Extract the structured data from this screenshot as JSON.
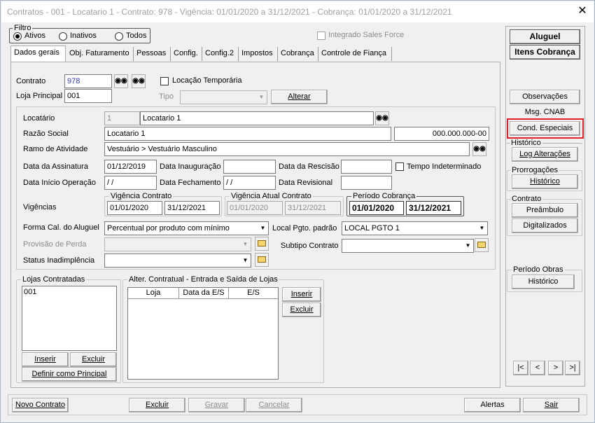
{
  "window": {
    "title": "Contratos - 001 - Locatario 1 - Contrato: 978 - Vigência: 01/01/2020 a 31/12/2021 - Cobrança: 01/01/2020 a 31/12/2021",
    "close": "✕"
  },
  "filtro": {
    "label": "Filtro",
    "options": [
      "Ativos",
      "Inativos",
      "Todos"
    ],
    "selected": "Ativos",
    "integrado": "Integrado Sales Force"
  },
  "tabs": [
    "Dados gerais",
    "Obj. Faturamento",
    "Pessoas",
    "Config.",
    "Config.2",
    "Impostos",
    "Cobrança",
    "Controle de Fiança"
  ],
  "contrato": {
    "label": "Contrato",
    "value": "978",
    "locacao_temporaria": "Locação Temporária",
    "loja_label": "Loja Principal",
    "loja_value": "001",
    "tipo_label": "Tipo",
    "alterar": "Alterar"
  },
  "form": {
    "locatario_label": "Locatário",
    "locatario_code": "1",
    "locatario_name": "Locatario 1",
    "razao_label": "Razão Social",
    "razao_value": "Locatario 1",
    "cnpj": "000.000.000-00",
    "ramo_label": "Ramo de Atividade",
    "ramo_value": "Vestuário > Vestuário Masculino",
    "assinatura_label": "Data da Assinatura",
    "assinatura_value": "01/12/2019",
    "inauguracao_label": "Data Inauguração",
    "rescisao_label": "Data da Rescisão",
    "tempo_indet": "Tempo Indeterminado",
    "inicio_op_label": "Data Início Operação",
    "inicio_op_value": " / /",
    "fechamento_label": "Data Fechamento",
    "fechamento_value": " / /",
    "revisional_label": "Data Revisional",
    "vigencias_label": "Vigências",
    "vig_contrato": {
      "title": "Vigência Contrato",
      "from": "01/01/2020",
      "to": "31/12/2021"
    },
    "vig_atual": {
      "title": "Vigência Atual Contrato",
      "from": "01/01/2020",
      "to": "31/12/2021"
    },
    "periodo_cob": {
      "title": "Período Cobrança",
      "from": "01/01/2020",
      "to": "31/12/2021"
    },
    "forma_label": "Forma Cal. do Aluguel",
    "forma_value": "Percentual por produto com mínimo",
    "local_label": "Local Pgto. padrão",
    "local_value": "LOCAL PGTO 1",
    "provisao_label": "Provisão de Perda",
    "subtipo_label": "Subtipo Contrato",
    "status_label": "Status Inadimplência"
  },
  "lojas": {
    "title": "Lojas Contratadas",
    "items": [
      "001"
    ],
    "inserir": "Inserir",
    "excluir": "Excluir",
    "definir": "Definir como Principal"
  },
  "alter": {
    "title": "Alter. Contratual - Entrada e Saída de Lojas",
    "columns": [
      "Loja",
      "Data da E/S",
      "E/S"
    ],
    "inserir": "Inserir",
    "excluir": "Excluir"
  },
  "side": {
    "aluguel": "Aluguel",
    "itens": "Itens Cobrança",
    "observacoes": "Observações",
    "cnab": "Msg. CNAB",
    "cond": "Cond. Especiais",
    "historico_title": "Histórico",
    "log": "Log Alterações",
    "prorrogacoes_title": "Prorrogações",
    "prorrog_hist": "Histórico",
    "contrato_title": "Contrato",
    "preambulo": "Preâmbulo",
    "digitalizados": "Digitalizados",
    "obras_title": "Período Obras",
    "obras_hist": "Histórico",
    "nav": [
      "|<",
      "<",
      ">",
      ">|"
    ]
  },
  "bottom": {
    "novo": "Novo Contrato",
    "excluir": "Excluir",
    "gravar": "Gravar",
    "cancelar": "Cancelar",
    "alertas": "Alertas",
    "sair": "Sair"
  },
  "colors": {
    "highlight": "#e0202a",
    "code_blue": "#2e39b8"
  }
}
